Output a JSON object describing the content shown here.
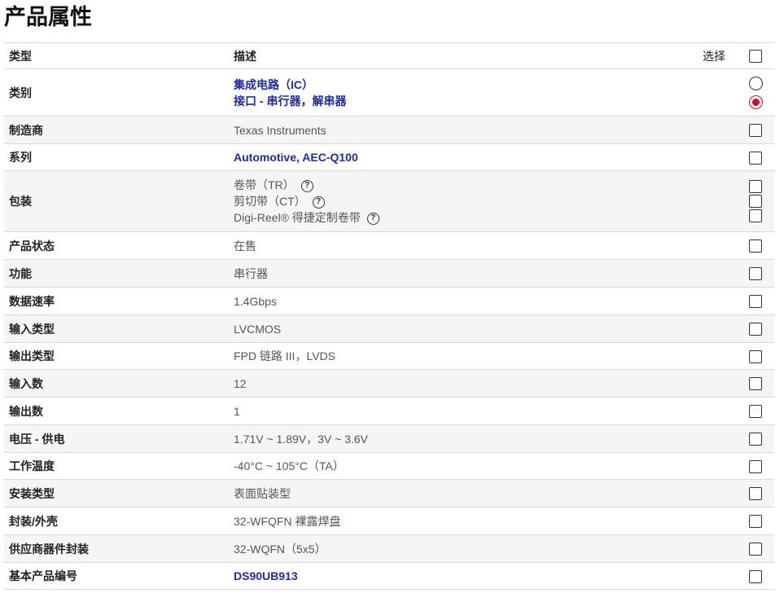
{
  "page_title": "产品属性",
  "header": {
    "type": "类型",
    "desc": "描述",
    "select": "选择"
  },
  "rows": {
    "category": {
      "label": "类别",
      "values": [
        "集成电路（IC）",
        "接口 - 串行器，解串器"
      ]
    },
    "manufacturer": {
      "label": "制造商",
      "value": "Texas Instruments"
    },
    "series": {
      "label": "系列",
      "value": "Automotive, AEC-Q100"
    },
    "packaging": {
      "label": "包装",
      "values": [
        "卷带（TR）",
        "剪切带（CT）",
        "Digi-Reel® 得捷定制卷带"
      ]
    },
    "status": {
      "label": "产品状态",
      "value": "在售"
    },
    "function": {
      "label": "功能",
      "value": "串行器"
    },
    "data_rate": {
      "label": "数据速率",
      "value": "1.4Gbps"
    },
    "input_type": {
      "label": "输入类型",
      "value": "LVCMOS"
    },
    "output_type": {
      "label": "输出类型",
      "value": "FPD 链路 III，LVDS"
    },
    "num_inputs": {
      "label": "输入数",
      "value": "12"
    },
    "num_outputs": {
      "label": "输出数",
      "value": "1"
    },
    "voltage": {
      "label": "电压 - 供电",
      "value": "1.71V ~ 1.89V，3V ~ 3.6V"
    },
    "temperature": {
      "label": "工作温度",
      "value": "-40°C ~ 105°C（TA）"
    },
    "mounting": {
      "label": "安装类型",
      "value": "表面贴装型"
    },
    "package_case": {
      "label": "封装/外壳",
      "value": "32-WFQFN 裸露焊盘"
    },
    "supplier_package": {
      "label": "供应商器件封装",
      "value": "32-WQFN（5x5）"
    },
    "base_part": {
      "label": "基本产品编号",
      "value": "DS90UB913"
    }
  },
  "icons": {
    "help": "question-circle-icon"
  },
  "colors": {
    "link": "#1f2aa6",
    "radio_selected": "#c8102e"
  }
}
